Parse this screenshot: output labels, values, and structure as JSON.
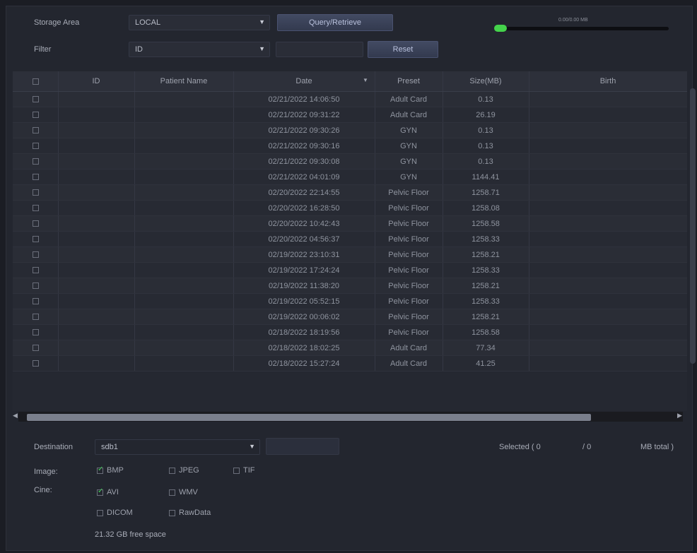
{
  "storage": {
    "label": "Storage Area",
    "value": "LOCAL"
  },
  "query_button": "Query/Retrieve",
  "filter": {
    "label": "Filter",
    "value": "ID",
    "text": "",
    "reset_label": "Reset"
  },
  "progress": {
    "text": "0.00/0.00 MB",
    "fraction": 0.0
  },
  "table": {
    "headers": [
      "ID",
      "Patient Name",
      "Date",
      "Preset",
      "Size(MB)",
      "Birth"
    ],
    "rows": [
      {
        "date": "02/21/2022 14:06:50",
        "preset": "Adult Card",
        "size": "0.13"
      },
      {
        "date": "02/21/2022 09:31:22",
        "preset": "Adult Card",
        "size": "26.19"
      },
      {
        "date": "02/21/2022 09:30:26",
        "preset": "GYN",
        "size": "0.13"
      },
      {
        "date": "02/21/2022 09:30:16",
        "preset": "GYN",
        "size": "0.13"
      },
      {
        "date": "02/21/2022 09:30:08",
        "preset": "GYN",
        "size": "0.13"
      },
      {
        "date": "02/21/2022 04:01:09",
        "preset": "GYN",
        "size": "1144.41"
      },
      {
        "date": "02/20/2022 22:14:55",
        "preset": "Pelvic Floor",
        "size": "1258.71"
      },
      {
        "date": "02/20/2022 16:28:50",
        "preset": "Pelvic Floor",
        "size": "1258.08"
      },
      {
        "date": "02/20/2022 10:42:43",
        "preset": "Pelvic Floor",
        "size": "1258.58"
      },
      {
        "date": "02/20/2022 04:56:37",
        "preset": "Pelvic Floor",
        "size": "1258.33"
      },
      {
        "date": "02/19/2022 23:10:31",
        "preset": "Pelvic Floor",
        "size": "1258.21"
      },
      {
        "date": "02/19/2022 17:24:24",
        "preset": "Pelvic Floor",
        "size": "1258.33"
      },
      {
        "date": "02/19/2022 11:38:20",
        "preset": "Pelvic Floor",
        "size": "1258.21"
      },
      {
        "date": "02/19/2022 05:52:15",
        "preset": "Pelvic Floor",
        "size": "1258.33"
      },
      {
        "date": "02/19/2022 00:06:02",
        "preset": "Pelvic Floor",
        "size": "1258.21"
      },
      {
        "date": "02/18/2022 18:19:56",
        "preset": "Pelvic Floor",
        "size": "1258.58"
      },
      {
        "date": "02/18/2022 18:02:25",
        "preset": "Adult Card",
        "size": "77.34"
      },
      {
        "date": "02/18/2022 15:27:24",
        "preset": "Adult Card",
        "size": "41.25"
      }
    ]
  },
  "destination": {
    "label": "Destination",
    "value": "sdb1",
    "button": ""
  },
  "selected": {
    "prefix": "Selected ( 0",
    "mid": "/ 0",
    "suffix": "MB total )"
  },
  "image": {
    "label": "Image:",
    "bmp": "BMP",
    "jpeg": "JPEG",
    "tif": "TIF"
  },
  "cine": {
    "label": "Cine:",
    "avi": "AVI",
    "wmv": "WMV",
    "dicom": "DICOM",
    "rawdata": "RawData"
  },
  "free_space": "21.32 GB free space",
  "colors": {
    "accent": "#44d34b",
    "background": "#23262f"
  }
}
